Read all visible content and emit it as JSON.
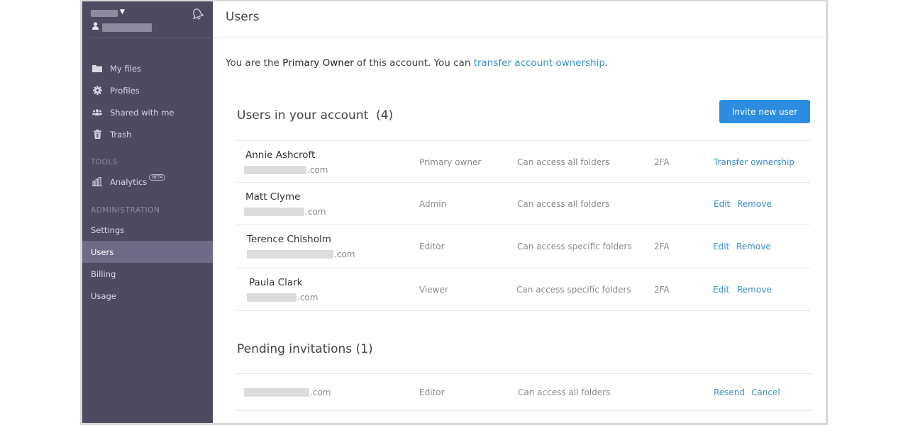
{
  "sidebar": {
    "nav": [
      {
        "label": "My files",
        "icon": "folder-icon"
      },
      {
        "label": "Profiles",
        "icon": "gear-icon"
      },
      {
        "label": "Shared with me",
        "icon": "users-icon"
      },
      {
        "label": "Trash",
        "icon": "trash-icon"
      }
    ],
    "tools_heading": "TOOLS",
    "analytics_label": "Analytics",
    "beta_badge": "BETA",
    "admin_heading": "ADMINISTRATION",
    "admin_items": [
      {
        "label": "Settings"
      },
      {
        "label": "Users"
      },
      {
        "label": "Billing"
      },
      {
        "label": "Usage"
      }
    ]
  },
  "header": {
    "title": "Users"
  },
  "ownership": {
    "prefix": "You are the ",
    "role": "Primary Owner",
    "middle": " of this account. You can ",
    "link": "transfer account ownership",
    "suffix": "."
  },
  "users_section": {
    "title": "Users in your account",
    "count": "(4)",
    "invite_label": "Invite new user",
    "users": [
      {
        "name": "Annie Ashcroft",
        "email_suffix": ".com",
        "role": "Primary owner",
        "access": "Can access all folders",
        "twofa": "2FA",
        "action1": "Transfer ownership",
        "action2": ""
      },
      {
        "name": "Matt Clyme",
        "email_suffix": ".com",
        "role": "Admin",
        "access": "Can access all folders",
        "twofa": "",
        "action1": "Edit",
        "action2": "Remove"
      },
      {
        "name": "Terence Chisholm",
        "email_suffix": ".com",
        "role": "Editor",
        "access": "Can access specific folders",
        "twofa": "2FA",
        "action1": "Edit",
        "action2": "Remove"
      },
      {
        "name": "Paula Clark",
        "email_suffix": ".com",
        "role": "Viewer",
        "access": "Can access specific folders",
        "twofa": "2FA",
        "action1": "Edit",
        "action2": "Remove"
      }
    ]
  },
  "pending_section": {
    "title": "Pending invitations",
    "count": "(1)",
    "invitations": [
      {
        "email_suffix": ".com",
        "role": "Editor",
        "access": "Can access all folders",
        "resend": "Resend",
        "cancel": "Cancel"
      }
    ]
  },
  "colors": {
    "sidebar_bg": "#4e4b61",
    "sidebar_active": "#6f6b86",
    "accent": "#2c8de0",
    "link": "#3a8fc7"
  }
}
